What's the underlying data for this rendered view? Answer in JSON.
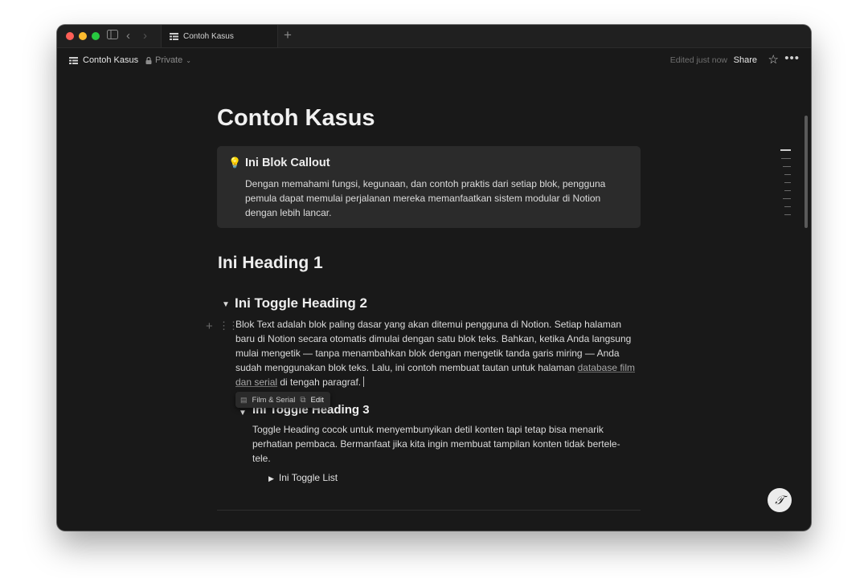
{
  "tab": {
    "title": "Contoh Kasus",
    "new_tab": "+"
  },
  "topbar": {
    "breadcrumb": "Contoh Kasus",
    "privacy": "Private",
    "edited": "Edited just now",
    "share": "Share"
  },
  "page": {
    "title": "Contoh Kasus",
    "callout": {
      "icon": "💡",
      "title": "Ini Blok Callout",
      "body": "Dengan memahami fungsi, kegunaan, dan contoh praktis dari setiap blok, pengguna pemula dapat memulai perjalanan mereka memanfaatkan sistem modular di Notion dengan lebih lancar."
    },
    "heading1": "Ini Heading 1",
    "toggle_heading2": "Ini Toggle Heading 2",
    "paragraph": {
      "text": "Blok Text adalah blok paling dasar yang akan ditemui pengguna di Notion. Setiap halaman baru di Notion secara otomatis dimulai dengan satu blok teks. Bahkan, ketika Anda langsung mulai mengetik — tanpa menambahkan blok dengan mengetik tanda garis miring — Anda sudah menggunakan blok teks. Lalu, ini contoh membuat tautan untuk halaman ",
      "link": "database film dan serial",
      "after": " di tengah paragraf."
    },
    "link_popup": {
      "page": "Film & Serial",
      "edit": "Edit"
    },
    "toggle_heading3": "Ini Toggle Heading 3",
    "paragraph2": "Toggle Heading cocok untuk menyembunyikan detil konten tapi tetap bisa menarik perhatian pembaca. Bermanfaat jika kita ingin membuat tampilan konten tidak bertele-tele.",
    "toggle_list": "Ini Toggle List"
  },
  "help_button": "?"
}
